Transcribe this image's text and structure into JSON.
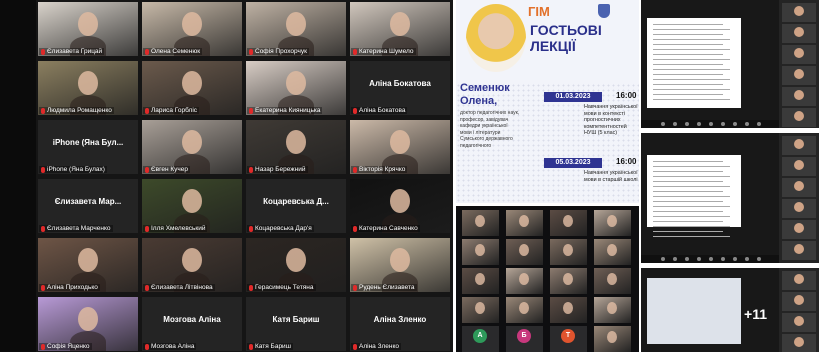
{
  "left_gallery": {
    "tiles": [
      {
        "name": "Єлизавета Грицай",
        "shows_name_only": false,
        "active": false,
        "photo": "#d9d3cb"
      },
      {
        "name": "Олена Семенюк",
        "shows_name_only": false,
        "active": false,
        "photo": "#c7b9a8"
      },
      {
        "name": "Софія Прохорчук",
        "shows_name_only": false,
        "active": false,
        "photo": "#bfb2a4"
      },
      {
        "name": "Катерина Шумело",
        "shows_name_only": false,
        "active": false,
        "photo": "#d1c7bd"
      },
      {
        "name": "Людмила Ромащенко",
        "shows_name_only": false,
        "active": true,
        "photo": "#8b7f60"
      },
      {
        "name": "Лариса Горбліс",
        "shows_name_only": false,
        "active": false,
        "photo": "#6b5a4c"
      },
      {
        "name": "Екатерина Кияницька",
        "shows_name_only": false,
        "active": false,
        "photo": "#d8cdc5"
      },
      {
        "name": "Аліна Бокатова",
        "shows_name_only": true,
        "active": false,
        "photo": ""
      },
      {
        "name": "iPhone (Яна Бул...",
        "label": "iPhone (Яна Булах)",
        "shows_name_only": true,
        "active": false,
        "photo": ""
      },
      {
        "name": "Євген Кучер",
        "shows_name_only": false,
        "active": false,
        "photo": "#a89f97"
      },
      {
        "name": "Назар Бережний",
        "shows_name_only": false,
        "active": false,
        "photo": "#3f3a35"
      },
      {
        "name": "Вікторія Крячко",
        "shows_name_only": false,
        "active": false,
        "photo": "#cbb9a8"
      },
      {
        "name": "Єлизавета Мар...",
        "label": "Єлизавета Марченко",
        "shows_name_only": true,
        "active": false,
        "photo": ""
      },
      {
        "name": "Ілля Хмелевський",
        "shows_name_only": false,
        "active": false,
        "photo": "#3d4a2a"
      },
      {
        "name": "Коцаревська Д...",
        "label": "Коцаревська Дар'я",
        "shows_name_only": true,
        "active": false,
        "photo": ""
      },
      {
        "name": "Катерина Савченко",
        "shows_name_only": false,
        "active": false,
        "photo": "#111111"
      },
      {
        "name": "Аліна Приходько",
        "shows_name_only": false,
        "active": false,
        "photo": "#6e5546"
      },
      {
        "name": "Єлизавета Літвінова",
        "shows_name_only": false,
        "active": false,
        "photo": "#4a3b33"
      },
      {
        "name": "Герасимець Тетяна",
        "shows_name_only": false,
        "active": false,
        "photo": "#2c2622"
      },
      {
        "name": "Рудень Єлизавета",
        "shows_name_only": false,
        "active": false,
        "photo": "#cfc1a7"
      },
      {
        "name": "Софія Яценко",
        "shows_name_only": false,
        "active": false,
        "photo": "#b89ad6"
      },
      {
        "name": "Мозгова Аліна",
        "shows_name_only": true,
        "active": false,
        "photo": ""
      },
      {
        "name": "Катя Бариш",
        "shows_name_only": true,
        "active": false,
        "photo": ""
      },
      {
        "name": "Аліна Зленко",
        "shows_name_only": true,
        "active": false,
        "photo": ""
      }
    ]
  },
  "poster": {
    "logo": "ГІМ",
    "title_line1": "ГОСТЬОВІ",
    "title_line2": "ЛЕКЦІЇ",
    "speaker_line1": "Семенюк",
    "speaker_line2": "Олена,",
    "speaker_desc": "доктор педагогічних наук, професор, завідувач кафедри української мови і літератури Сумського державного педагогічного",
    "events": [
      {
        "date": "01.03.2023",
        "time": "16:00",
        "topic": "Навчання української мови в контексті прогностичних компетентностей НУШ (5 клас)"
      },
      {
        "date": "05.03.2023",
        "time": "16:00",
        "topic": "Навчання української мови в старшій школі"
      }
    ],
    "accent_color": "#2f3492",
    "highlight_color": "#e2712b"
  },
  "mid_gallery": {
    "avatars": [
      {
        "letter": "А",
        "color": "#2e9a5a"
      },
      {
        "letter": "Б",
        "color": "#c8387d"
      },
      {
        "letter": "Т",
        "color": "#e0542e"
      }
    ]
  },
  "right_panel": {
    "more_count": "+11"
  }
}
